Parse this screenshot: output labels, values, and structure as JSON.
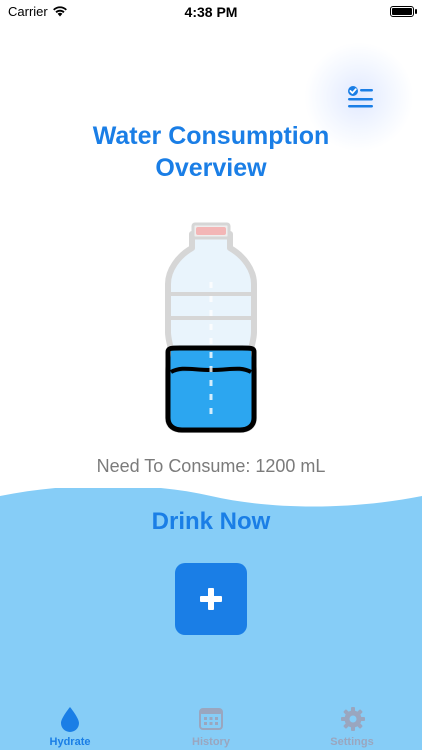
{
  "status_bar": {
    "carrier": "Carrier",
    "time": "4:38 PM"
  },
  "header": {
    "title_line1": "Water Consumption",
    "title_line2": "Overview",
    "report_icon": "report-checklist-icon"
  },
  "hydration": {
    "need_text": "Need To Consume: 1200 mL",
    "bottle_fill_fraction": 0.45
  },
  "action": {
    "title": "Drink Now",
    "add_icon": "plus-icon"
  },
  "tabs": [
    {
      "label": "Hydrate",
      "icon": "water-drop-icon",
      "active": true
    },
    {
      "label": "History",
      "icon": "calendar-icon",
      "active": false
    },
    {
      "label": "Settings",
      "icon": "gear-icon",
      "active": false
    }
  ],
  "colors": {
    "accent": "#1a7ee6",
    "water_light": "#86cdf7",
    "bottle_water": "#2ca6f0",
    "muted_text": "#7b7b7b",
    "tab_inactive": "#9aa6bf"
  }
}
